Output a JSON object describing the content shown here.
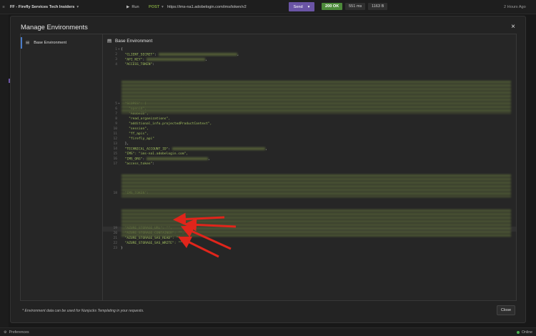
{
  "topbar": {
    "workspace": "FF - Firefly Services Tech Insiders",
    "run_label": "Run",
    "method": "POST",
    "url": "https://ims-na1.adobelogin.com/ims/token/v2",
    "send_label": "Send",
    "status": "200 OK",
    "time": "551 ms",
    "size": "1163 B",
    "ago": "2 Hours Ago"
  },
  "modal": {
    "title": "Manage Environments",
    "env_item": "Base Environment",
    "editor_title": "Base Environment",
    "footer_note": "* Environment data can be used for Nunjucks Templating in your requests.",
    "close_label": "Close"
  },
  "code": {
    "l1": "{",
    "l2_key": "\"CLIENT_SECRET\"",
    "l3_key": "\"API_KEY\"",
    "l4_key": "\"ACCESS_TOKEN\"",
    "l5": "\"SCOPES\": [",
    "l6": "\"openid\",",
    "l7": "\"AdobeID\",",
    "l8": "\"read_organizations\",",
    "l9": "\"additional_info.projectedProductContext\",",
    "l10": "\"session\",",
    "l11": "\"ff_apis\",",
    "l12": "\"firefly_api\"",
    "l13": "],",
    "l14_key": "\"TECHNICAL_ACCOUNT_ID\"",
    "l15": "\"IMS\": \"ims-na1.adobelogin.com\",",
    "l16_key": "\"IMS_ORG\"",
    "l17_key": "\"access_token\"",
    "l18_key": "\"IMS_TOKEN\"",
    "l19": "\"AZURE_STORAGE_URL\": \"\",",
    "l20": "\"AZURE_STORAGE_CONTAINER\": \"\",",
    "l21": "\"AZURE_STORAGE_SAS_READ\": \"\",",
    "l22": "\"AZURE_STORAGE_SAS_WRITE\": \"\"",
    "l23": "}"
  },
  "bottombar": {
    "preferences": "Preferences",
    "online": "Online"
  },
  "colors": {
    "accent": "#6a54a5",
    "success": "#4c8a3a",
    "code_green": "#a4c260",
    "arrow_red": "#e0251b"
  }
}
